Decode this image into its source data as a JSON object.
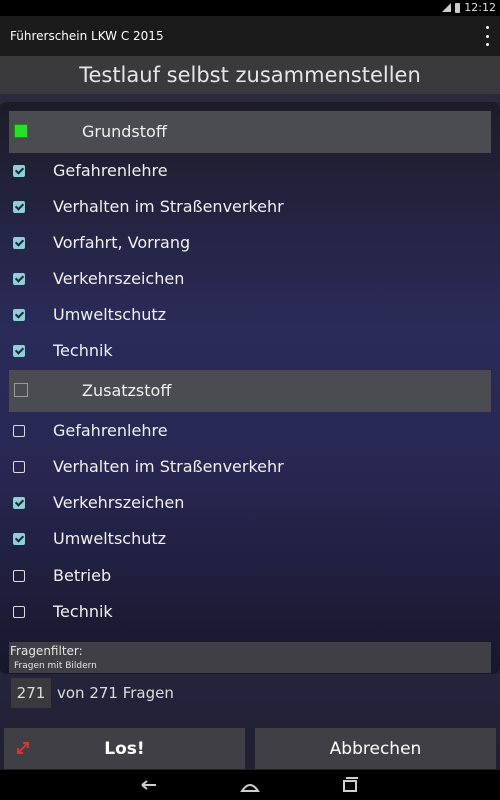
{
  "status": {
    "time": "12:12"
  },
  "app": {
    "title": "Führerschein LKW C 2015"
  },
  "page": {
    "title": "Testlauf selbst zusammenstellen"
  },
  "groups": [
    {
      "label": "Grundstoff",
      "checked": true,
      "items": [
        {
          "label": "Gefahrenlehre",
          "checked": true
        },
        {
          "label": "Verhalten im Straßenverkehr",
          "checked": true
        },
        {
          "label": "Vorfahrt, Vorrang",
          "checked": true
        },
        {
          "label": "Verkehrszeichen",
          "checked": true
        },
        {
          "label": "Umweltschutz",
          "checked": true
        },
        {
          "label": "Technik",
          "checked": true
        }
      ]
    },
    {
      "label": "Zusatzstoff",
      "checked": false,
      "items": [
        {
          "label": "Gefahrenlehre",
          "checked": false
        },
        {
          "label": "Verhalten im Straßenverkehr",
          "checked": false
        },
        {
          "label": "Verkehrszeichen",
          "checked": true
        },
        {
          "label": "Umweltschutz",
          "checked": true
        },
        {
          "label": "Betrieb",
          "checked": false
        },
        {
          "label": "Technik",
          "checked": false
        }
      ]
    }
  ],
  "filter": {
    "label": "Fragenfilter:",
    "value": "Fragen mit Bildern"
  },
  "count": {
    "value": "271",
    "text": "von 271 Fragen"
  },
  "buttons": {
    "go": "Los!",
    "cancel": "Abbrechen"
  },
  "colors": {
    "accent_green": "#27e027",
    "checkbox_checked": "#8fd0d6",
    "arrow_red": "#e03030"
  }
}
